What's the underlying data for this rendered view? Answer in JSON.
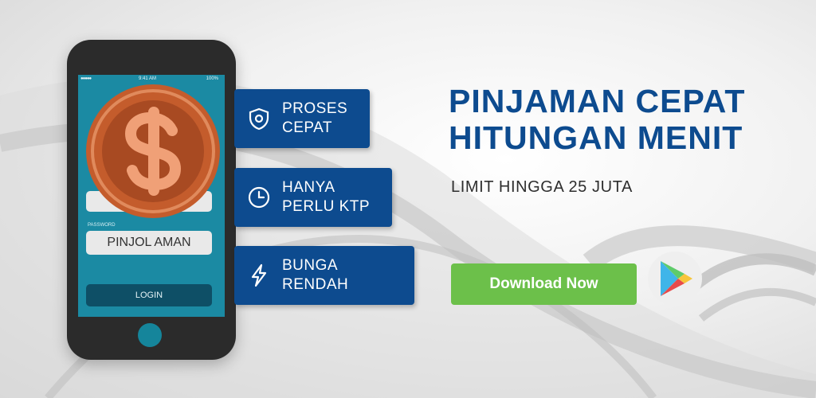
{
  "phone": {
    "status_time": "9:41 AM",
    "battery": "100%",
    "password_label": "PASSWORD",
    "password_value": "PINJOL AMAN",
    "login_label": "LOGIN"
  },
  "features": [
    {
      "line1": "PROSES",
      "line2": "CEPAT",
      "icon": "shield-icon"
    },
    {
      "line1": "HANYA",
      "line2": "PERLU KTP",
      "icon": "clock-icon"
    },
    {
      "line1": "BUNGA",
      "line2": "RENDAH",
      "icon": "lightning-icon"
    }
  ],
  "headline": {
    "line1": "PINJAMAN CEPAT",
    "line2": "HITUNGAN MENIT"
  },
  "subheadline": "LIMIT HINGGA 25 JUTA",
  "cta": {
    "label": "Download Now",
    "icon": "google-play-icon"
  },
  "colors": {
    "brand_blue": "#0d4b8f",
    "cta_green": "#6cc04a",
    "screen_teal": "#1b8aa3",
    "coin_orange": "#c45c2c"
  }
}
